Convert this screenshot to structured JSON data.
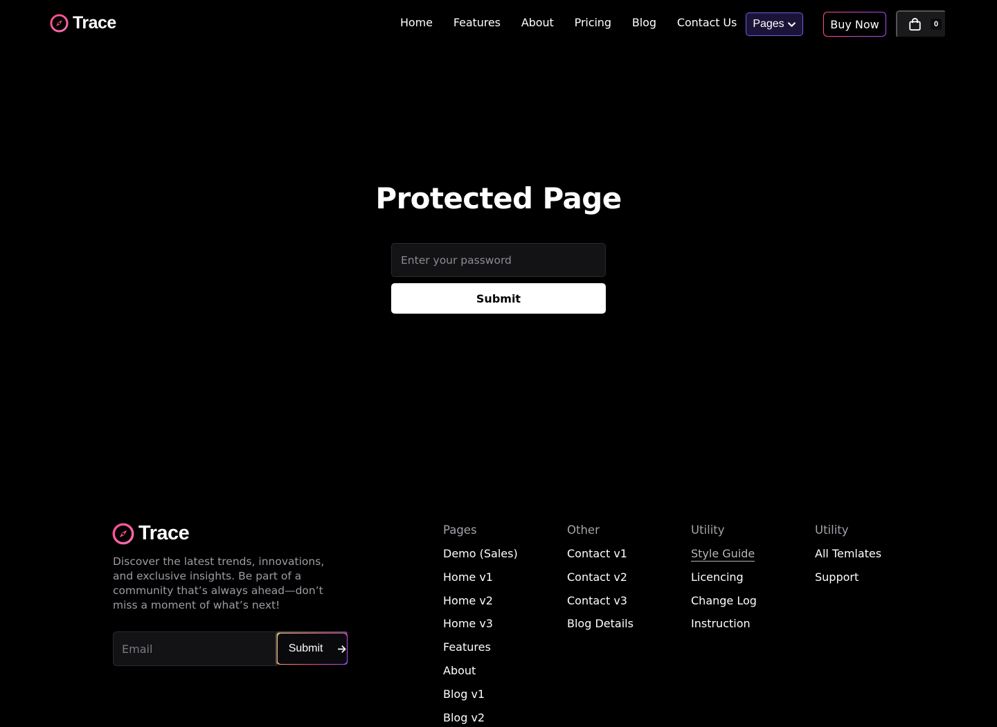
{
  "brand": {
    "name": "Trace",
    "accent_pink": "#ff4d8d",
    "accent_purple": "#a24dff",
    "icon": "compass-icon"
  },
  "nav": {
    "links": [
      "Home",
      "Features",
      "About",
      "Pricing",
      "Blog",
      "Contact Us"
    ],
    "pages_label": "Pages",
    "buy_label": "Buy Now",
    "cart_count": "0"
  },
  "main": {
    "title": "Protected Page",
    "password_placeholder": "Enter your password",
    "submit_label": "Submit"
  },
  "footer": {
    "description": "Discover the latest trends, innovations, and exclusive insights. Be part of a community that’s always ahead—don’t miss a moment of what’s next!",
    "email_placeholder": "Email",
    "submit_label": "Submit",
    "columns": [
      {
        "title": "Pages",
        "items": [
          "Demo (Sales)",
          "Home v1",
          "Home v2",
          "Home v3",
          "Features",
          "About",
          "Blog v1",
          "Blog v2"
        ]
      },
      {
        "title": "Other",
        "items": [
          "Contact v1",
          "Contact v2",
          "Contact v3",
          "Blog Details"
        ]
      },
      {
        "title": "Utility",
        "items": [
          "Style Guide",
          "Licencing",
          "Change Log",
          "Instruction"
        ],
        "active": "Style Guide"
      },
      {
        "title": "Utility",
        "items": [
          "All Temlates",
          "Support"
        ]
      }
    ]
  }
}
